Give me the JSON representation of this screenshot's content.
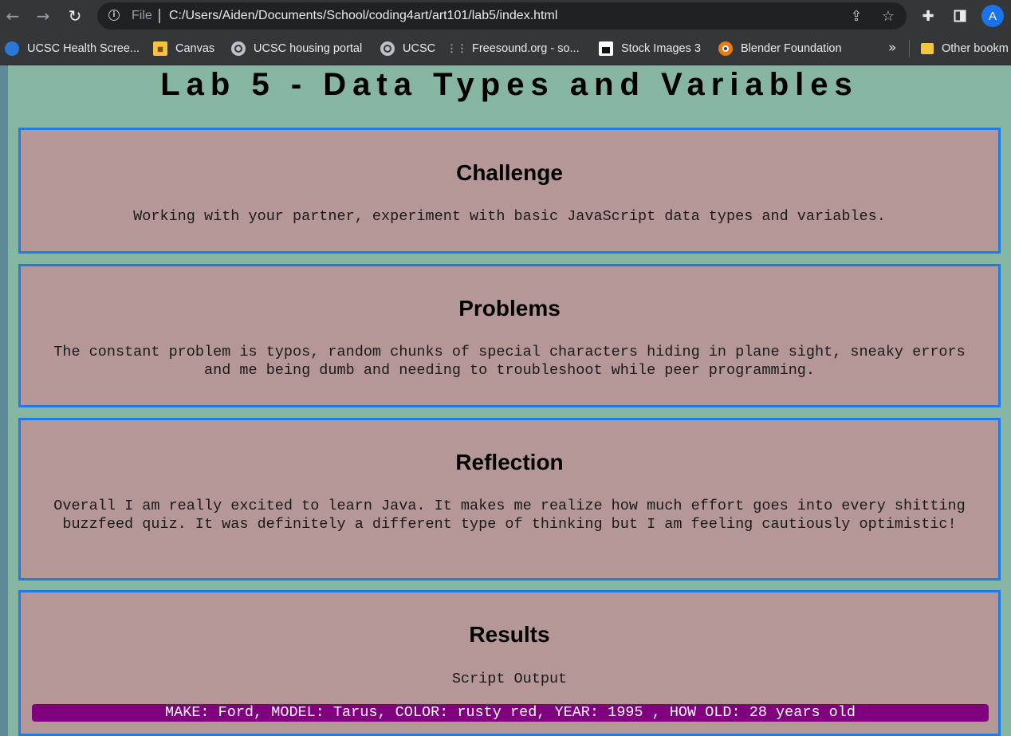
{
  "browser": {
    "file_label": "File",
    "url": "C:/Users/Aiden/Documents/School/coding4art/art101/lab5/index.html",
    "avatar_letter": "A",
    "bookmarks": [
      {
        "label": "UCSC Health Scree...",
        "icon": "ucsc-globe-icon"
      },
      {
        "label": "Canvas",
        "icon": "canvas-icon"
      },
      {
        "label": "UCSC housing portal",
        "icon": "globe-icon"
      },
      {
        "label": "UCSC",
        "icon": "globe-icon"
      },
      {
        "label": "Freesound.org - so...",
        "icon": "freesound-icon"
      },
      {
        "label": "Stock Images 3",
        "icon": "stock-images-icon"
      },
      {
        "label": "Blender Foundation",
        "icon": "blender-icon"
      }
    ],
    "more_bookmarks": "»",
    "other_bookmarks": "Other bookm"
  },
  "page": {
    "title": "Lab 5 - Data Types and Variables",
    "challenge": {
      "heading": "Challenge",
      "text": "Working with your partner, experiment with basic JavaScript data types and variables."
    },
    "problems": {
      "heading": "Problems",
      "text": "The constant problem is typos, random chunks of special characters hiding in plane sight, sneaky errors and me being dumb and needing to troubleshoot while peer programming."
    },
    "reflection": {
      "heading": "Reflection",
      "text": "Overall I am really excited to learn Java. It makes me realize how much effort goes into every shitting buzzfeed quiz. It was definitely a different type of thinking but I am feeling cautiously optimistic!"
    },
    "results": {
      "heading": "Results",
      "subtitle": "Script Output",
      "output": "MAKE: Ford, MODEL: Tarus, COLOR: rusty red, YEAR: 1995 , HOW OLD: 28 years old"
    }
  },
  "colors": {
    "page_bg": "#86b6a2",
    "card_bg": "#b69797",
    "card_border": "#1e7ce8",
    "output_bg": "#800080"
  }
}
